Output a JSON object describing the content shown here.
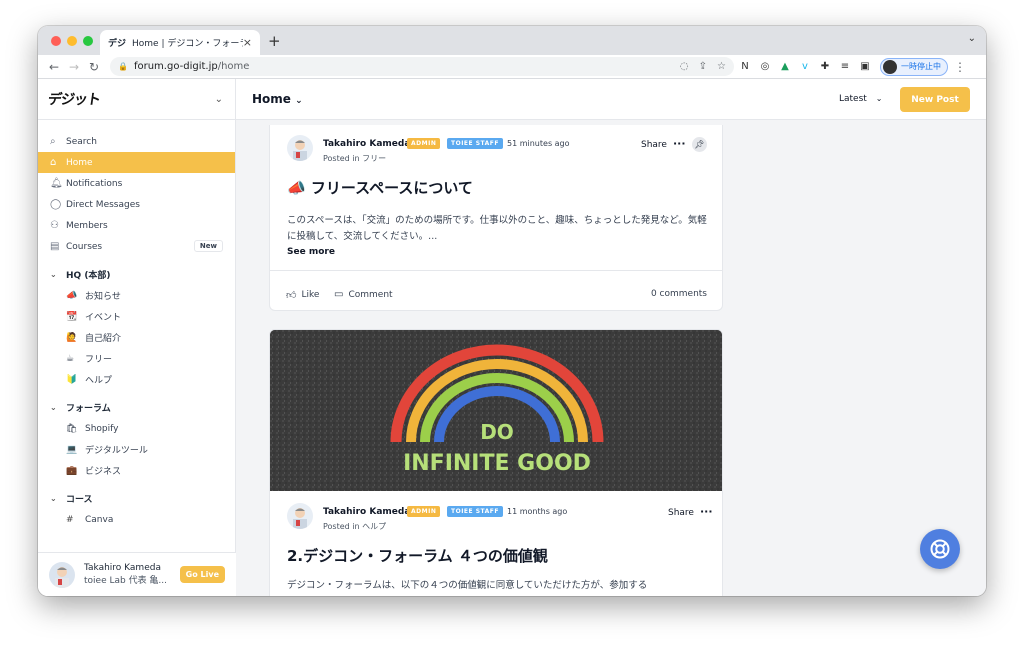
{
  "browser": {
    "tab_title": "Home | デジコン・フォーラム",
    "tab_favicon": "デジ",
    "new_tab": "+",
    "url_domain": "forum.go-digit.jp",
    "url_path": "/home",
    "profile_label": "一時停止中",
    "traffic_lights": [
      "#ff5f57",
      "#febc2e",
      "#28c840"
    ]
  },
  "sidebar": {
    "logo": "デジット",
    "nav": [
      {
        "label": "Search",
        "icon": "search-icon"
      },
      {
        "label": "Home",
        "icon": "home-icon",
        "active": true
      },
      {
        "label": "Notifications",
        "icon": "bell-icon"
      },
      {
        "label": "Direct Messages",
        "icon": "chat-icon"
      },
      {
        "label": "Members",
        "icon": "members-icon"
      },
      {
        "label": "Courses",
        "icon": "courses-icon",
        "badge": "New"
      }
    ],
    "sections": [
      {
        "title": "HQ (本部)",
        "items": [
          {
            "emoji": "📣",
            "label": "お知らせ"
          },
          {
            "emoji": "📆",
            "label": "イベント"
          },
          {
            "emoji": "🙋",
            "label": "自己紹介"
          },
          {
            "emoji": "☕",
            "label": "フリー"
          },
          {
            "emoji": "🔰",
            "label": "ヘルプ"
          }
        ]
      },
      {
        "title": "フォーラム",
        "items": [
          {
            "emoji": "🛍",
            "label": "Shopify"
          },
          {
            "emoji": "💻",
            "label": "デジタルツール"
          },
          {
            "emoji": "💼",
            "label": "ビジネス"
          }
        ]
      },
      {
        "title": "コース",
        "items": [
          {
            "emoji": "#",
            "label": "Canva"
          }
        ]
      }
    ],
    "footer": {
      "name": "Takahiro Kameda",
      "subtitle": "toiee Lab 代表 亀...",
      "go_live": "Go Live"
    }
  },
  "header": {
    "title": "Home",
    "sort": "Latest",
    "new_post": "New Post"
  },
  "posts": [
    {
      "author": "Takahiro Kameda",
      "badges": [
        "ADMIN",
        "TOIEE STAFF"
      ],
      "time": "51 minutes ago",
      "posted_in": "Posted in フリー",
      "share": "Share",
      "title": "📣 フリースペースについて",
      "body": "このスペースは、「交流」のための場所です。仕事以外のこと、趣味、ちょっとした発見など。気軽に投稿して、交流してください。...",
      "see_more": "See more",
      "like": "Like",
      "comment": "Comment",
      "comments_count": "0 comments"
    },
    {
      "author": "Takahiro Kameda",
      "badges": [
        "ADMIN",
        "TOIEE STAFF"
      ],
      "time": "11 months ago",
      "posted_in": "Posted in ヘルプ",
      "share": "Share",
      "title": "2.デジコン・フォーラム ４つの価値観",
      "body": "デジコン・フォーラムは、以下の４つの価値観に同意していただけた方が、参加する",
      "image_text_line1": "DO",
      "image_text_line2": "INFINITE GOOD"
    }
  ],
  "colors": {
    "accent": "#f5c04a",
    "admin_badge": "#f5b942",
    "staff_badge": "#5aa9f0",
    "help_fab": "#4f7fe0"
  }
}
